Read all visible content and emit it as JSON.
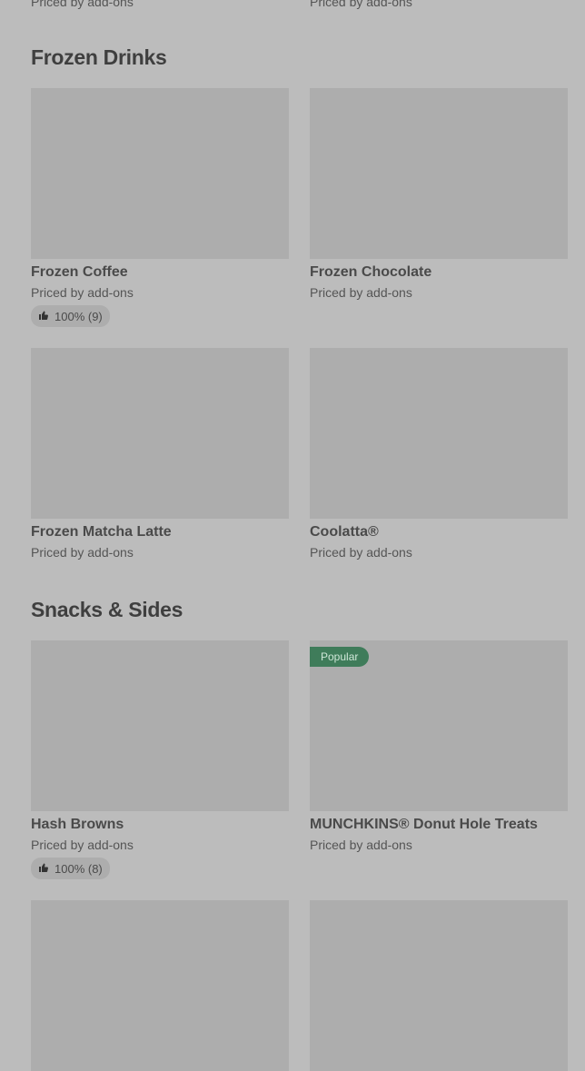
{
  "top_partial": {
    "left_price": "Priced by add-ons",
    "right_price": "Priced by add-ons"
  },
  "sections": [
    {
      "title": "Frozen Drinks",
      "items": [
        {
          "name": "Frozen Coffee",
          "price": "Priced by add-ons",
          "rating": "100% (9)"
        },
        {
          "name": "Frozen Chocolate",
          "price": "Priced by add-ons"
        },
        {
          "name": "Frozen Matcha Latte",
          "price": "Priced by add-ons"
        },
        {
          "name": "Coolatta®",
          "price": "Priced by add-ons"
        }
      ]
    },
    {
      "title": "Snacks & Sides",
      "items": [
        {
          "name": "Hash Browns",
          "price": "Priced by add-ons",
          "rating": "100% (8)"
        },
        {
          "name": "MUNCHKINS® Donut Hole Treats",
          "price": "Priced by add-ons",
          "badge": "Popular"
        }
      ]
    }
  ],
  "icons": {
    "rating": "thumbs-up-icon"
  },
  "colors": {
    "badge_bg": "#3f7c5a",
    "background": "#bcbcbc",
    "image_placeholder": "#adadad"
  }
}
